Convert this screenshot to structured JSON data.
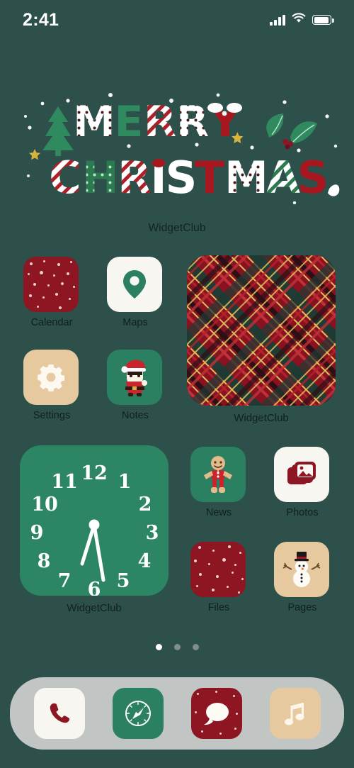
{
  "status_bar": {
    "time": "2:41",
    "signal_icon": "cellular-bars-icon",
    "wifi_icon": "wifi-icon",
    "battery_icon": "battery-icon"
  },
  "hero_widget": {
    "line1": "MERRY",
    "line2": "CHRISTMAS",
    "label": "WidgetClub",
    "decorations": [
      "christmas-tree",
      "holly-leaves",
      "gold-star",
      "snowflake-dots",
      "santa-hat-accent"
    ],
    "colors": {
      "background": "#2d504b",
      "red": "#9e1b23",
      "green": "#2f8a5f",
      "white": "#ffffff",
      "gold": "#d9b43c"
    }
  },
  "home_screen": {
    "background_color": "#2d504b",
    "apps_row1": [
      {
        "label": "Calendar",
        "icon": "calendar-snow-icon",
        "bg": "#8d1622",
        "style": "red-snow"
      },
      {
        "label": "Maps",
        "icon": "map-pin-icon",
        "bg": "#f8f6f1",
        "style": "cream"
      }
    ],
    "apps_row2": [
      {
        "label": "Settings",
        "icon": "gear-icon",
        "bg": "#e6c99f",
        "style": "tan"
      },
      {
        "label": "Notes",
        "icon": "santa-icon",
        "bg": "#2a8060",
        "style": "green"
      }
    ],
    "apps_right1": [
      {
        "label": "News",
        "icon": "gingerbread-man-icon",
        "bg": "#2a8060",
        "style": "green"
      },
      {
        "label": "Photos",
        "icon": "photos-stack-icon",
        "bg": "#f8f6f1",
        "style": "cream"
      }
    ],
    "apps_right2": [
      {
        "label": "Files",
        "icon": "files-snow-icon",
        "bg": "#8d1622",
        "style": "red-snow"
      },
      {
        "label": "Pages",
        "icon": "snowman-icon",
        "bg": "#e6c99f",
        "style": "tan"
      }
    ],
    "plaid_widget": {
      "label": "WidgetClub",
      "icon": "tartan-plaid-widget"
    },
    "clock_widget": {
      "label": "WidgetClub",
      "icon": "analog-clock-widget",
      "numerals": [
        "12",
        "1",
        "2",
        "3",
        "4",
        "5",
        "6",
        "7",
        "8",
        "9",
        "10",
        "11"
      ],
      "background": "#2d8663",
      "hand_color": "#ffffff"
    },
    "page_dots": {
      "total": 3,
      "active_index": 0
    }
  },
  "dock": {
    "items": [
      {
        "label": "Phone",
        "icon": "phone-icon",
        "bg": "#f8f6f1",
        "fg": "#8d1622"
      },
      {
        "label": "Safari",
        "icon": "compass-icon",
        "bg": "#2a8060",
        "fg": "#ffffff"
      },
      {
        "label": "Messages",
        "icon": "message-bubble-icon",
        "bg": "#8d1622",
        "fg": "#ffffff"
      },
      {
        "label": "Music",
        "icon": "music-note-icon",
        "bg": "#e6c99f",
        "fg": "#fdf6ea"
      }
    ]
  }
}
